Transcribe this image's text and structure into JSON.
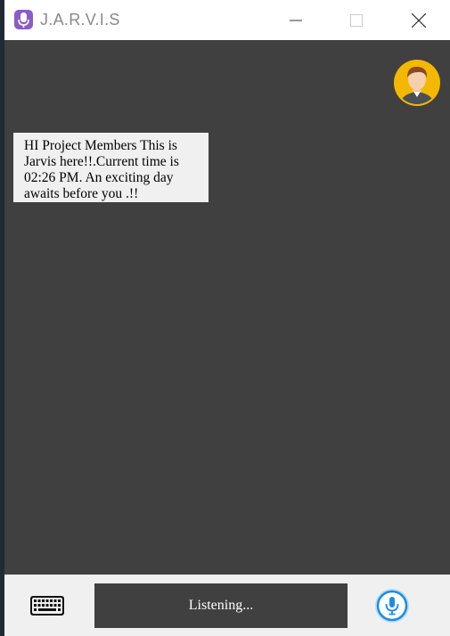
{
  "window": {
    "title": "J.A.R.V.I.S",
    "app_icon": "microphone-app-icon",
    "controls": [
      "minimize-icon",
      "maximize-icon",
      "close-icon"
    ]
  },
  "chat": {
    "avatar_icon": "user-avatar-icon",
    "messages": [
      {
        "text": "HI Project Members This is Jarvis here!!.Current time is 02:26 PM. An exciting day awaits before you .!!"
      }
    ]
  },
  "bottom": {
    "keyboard_icon": "keyboard-icon",
    "status_text": "Listening...",
    "mic_icon": "microphone-icon"
  },
  "colors": {
    "chat_background": "#404040",
    "bubble_background": "#f0f0f0",
    "bar_background": "#f0f0f0",
    "avatar_ring": "#f5b800",
    "mic_accent": "#1e8ee0",
    "app_icon_accent": "#8b5cc7"
  }
}
